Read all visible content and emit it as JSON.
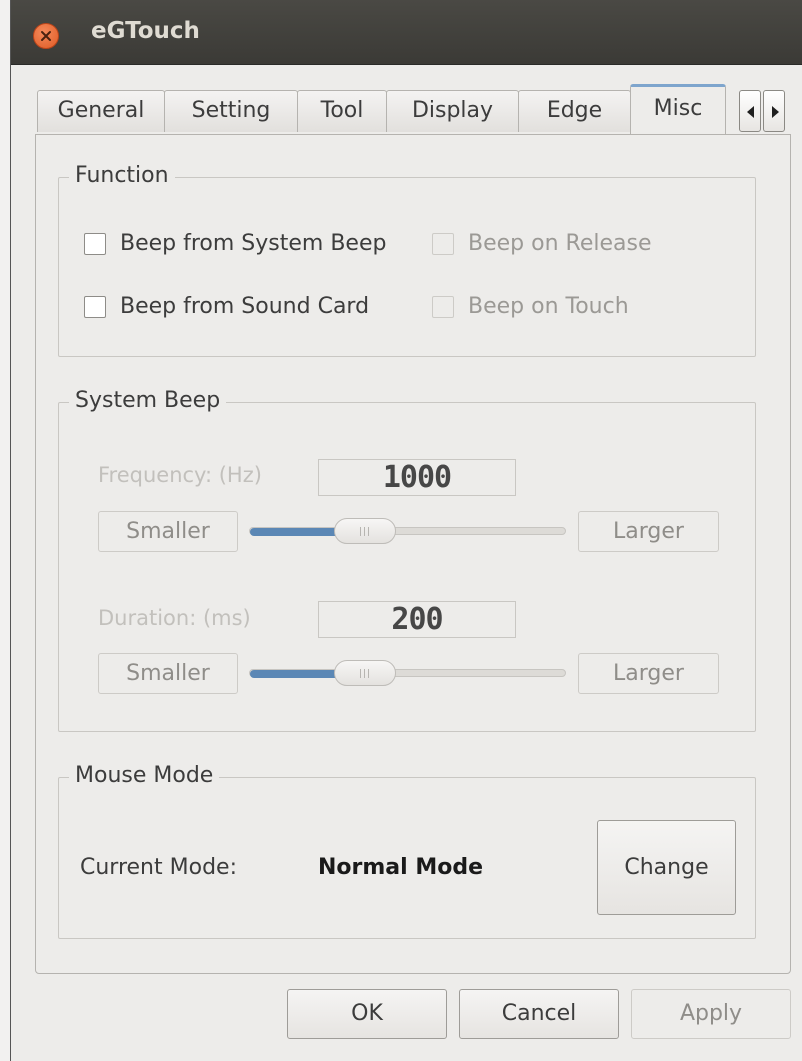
{
  "window": {
    "title": "eGTouch"
  },
  "tabs": [
    {
      "label": "General",
      "active": false
    },
    {
      "label": "Setting",
      "active": false
    },
    {
      "label": "Tool",
      "active": false
    },
    {
      "label": "Display",
      "active": false
    },
    {
      "label": "Edge",
      "active": false
    },
    {
      "label": "Misc",
      "active": true
    }
  ],
  "function_frame": {
    "title": "Function",
    "beep_system": {
      "label": "Beep from System Beep",
      "checked": false
    },
    "beep_sound_card": {
      "label": "Beep from Sound Card",
      "checked": false
    },
    "beep_release": {
      "label": "Beep on Release",
      "checked": false,
      "enabled": false
    },
    "beep_touch": {
      "label": "Beep on Touch",
      "checked": false,
      "enabled": false
    }
  },
  "system_beep_frame": {
    "title": "System Beep",
    "frequency": {
      "label": "Frequency: (Hz)",
      "value": "1000",
      "smaller_label": "Smaller",
      "larger_label": "Larger",
      "slider_fraction": 0.28
    },
    "duration": {
      "label": "Duration: (ms)",
      "value": "200",
      "smaller_label": "Smaller",
      "larger_label": "Larger",
      "slider_fraction": 0.28
    }
  },
  "mouse_mode_frame": {
    "title": "Mouse Mode",
    "current_mode_label": "Current Mode:",
    "current_mode_value": "Normal Mode",
    "change_label": "Change"
  },
  "footer": {
    "ok_label": "OK",
    "cancel_label": "Cancel",
    "apply_label": "Apply"
  },
  "colors": {
    "accent": "#5b87b5",
    "active_tab_border": "#7ea5cd",
    "close_button": "#e05a24",
    "titlebar": "#3e3d39"
  }
}
